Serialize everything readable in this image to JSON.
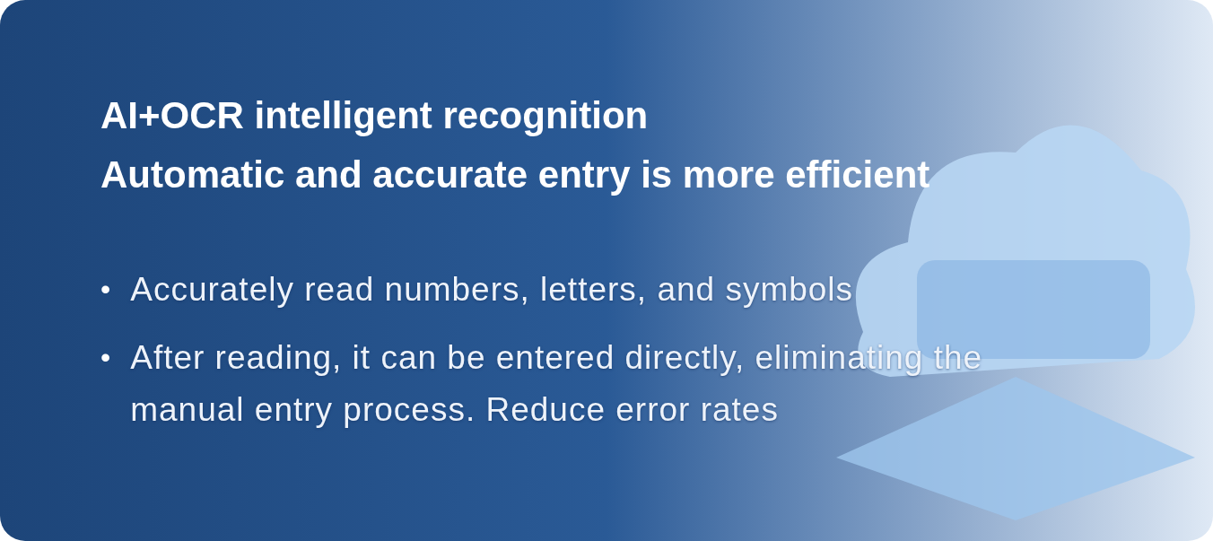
{
  "banner": {
    "title_lines": [
      "AI+OCR intelligent recognition",
      "Automatic and accurate entry is more efficient"
    ],
    "bullets": [
      {
        "marker": "•",
        "text": "Accurately read numbers, letters, and symbols"
      },
      {
        "marker": "•",
        "text": "After reading, it can be entered directly, eliminating the manual entry process. Reduce error rates"
      }
    ]
  }
}
